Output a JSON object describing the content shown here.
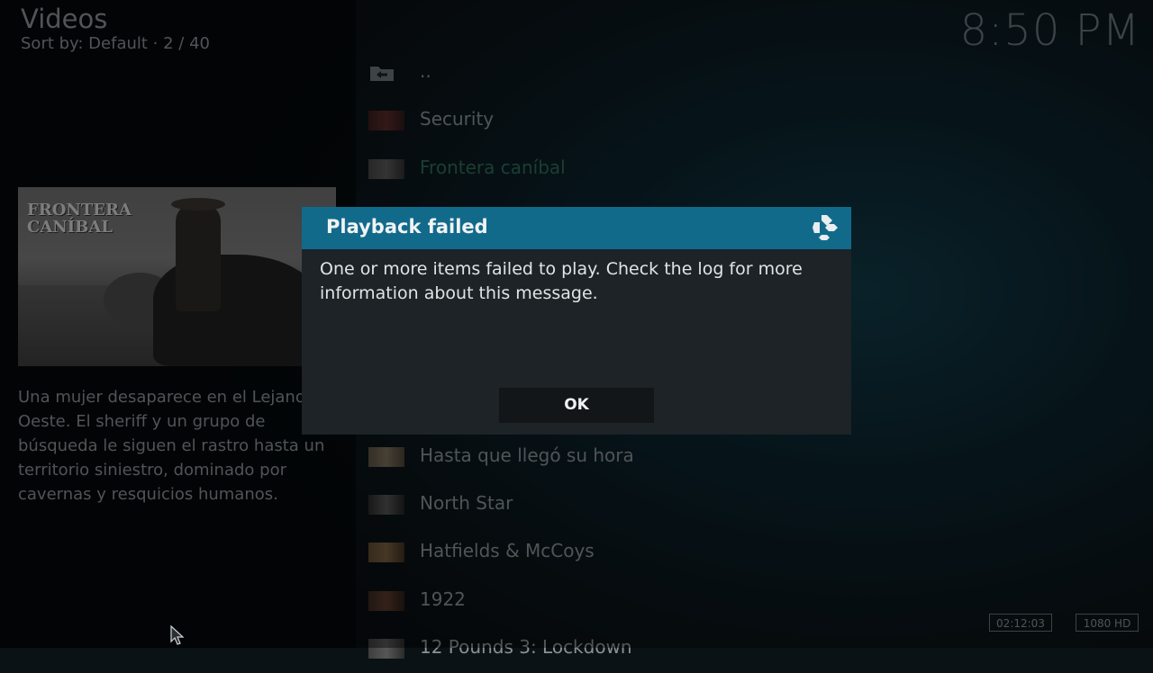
{
  "header": {
    "title": "Videos",
    "subtitle": "Sort by: Default  ·  2 / 40",
    "clock": "8:50 PM"
  },
  "detail": {
    "poster_title": "FRONTERA\nCANÍBAL",
    "plot": "Una mujer desaparece en el Lejano Oeste. El sheriff y un grupo de búsqueda le siguen el rastro hasta un territorio siniestro, dominado por cavernas y resquicios humanos."
  },
  "list": {
    "items": [
      {
        "label": "..",
        "icon": "folder-back-icon"
      },
      {
        "label": "Security"
      },
      {
        "label": "Frontera caníbal",
        "selected": true
      },
      {
        "label": "Hasta que llegó su hora"
      },
      {
        "label": "North Star"
      },
      {
        "label": "Hatfields & McCoys"
      },
      {
        "label": "1922"
      },
      {
        "label": "12 Pounds 3: Lockdown"
      }
    ]
  },
  "footer": {
    "duration": "02:12:03",
    "resolution": "1080 HD"
  },
  "dialog": {
    "title": "Playback failed",
    "message": "One or more items failed to play. Check the log for more information about this message.",
    "ok_label": "OK"
  },
  "colors": {
    "dialog_header": "#126a8b",
    "selected_text": "#2f6b57"
  }
}
